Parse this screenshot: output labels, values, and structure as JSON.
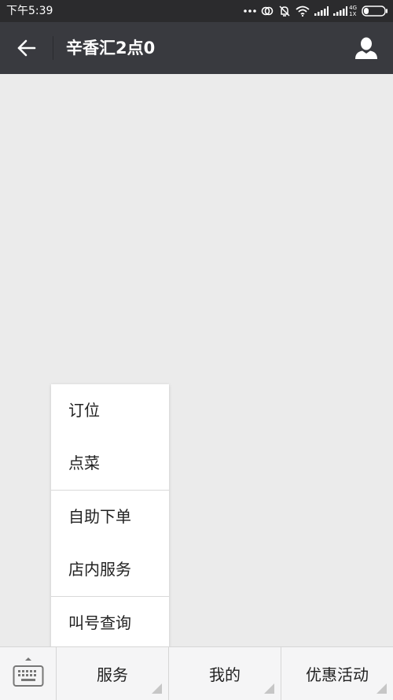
{
  "status_bar": {
    "time": "下午5:39",
    "network_top": "4G",
    "network_bottom": "1X",
    "icons": [
      "more-dots-icon",
      "sync-icon",
      "alarm-off-icon",
      "wifi-icon",
      "signal-icon",
      "signal-icon",
      "battery-icon"
    ]
  },
  "header": {
    "title": "辛香汇2点0",
    "back_icon": "arrow-left-icon",
    "profile_icon": "user-icon"
  },
  "popup_menu": {
    "groups": [
      {
        "items": [
          {
            "label": "订位"
          },
          {
            "label": "点菜"
          }
        ]
      },
      {
        "items": [
          {
            "label": "自助下单"
          },
          {
            "label": "店内服务"
          }
        ]
      },
      {
        "items": [
          {
            "label": "叫号查询"
          }
        ]
      }
    ]
  },
  "bottom_bar": {
    "keyboard_icon": "keyboard-icon",
    "tabs": [
      {
        "label": "服务"
      },
      {
        "label": "我的"
      },
      {
        "label": "优惠活动"
      }
    ]
  },
  "colors": {
    "status_bar": "#2b2b2d",
    "header": "#393a3f",
    "background": "#ebebeb",
    "bottom_bar": "#f5f5f6"
  }
}
